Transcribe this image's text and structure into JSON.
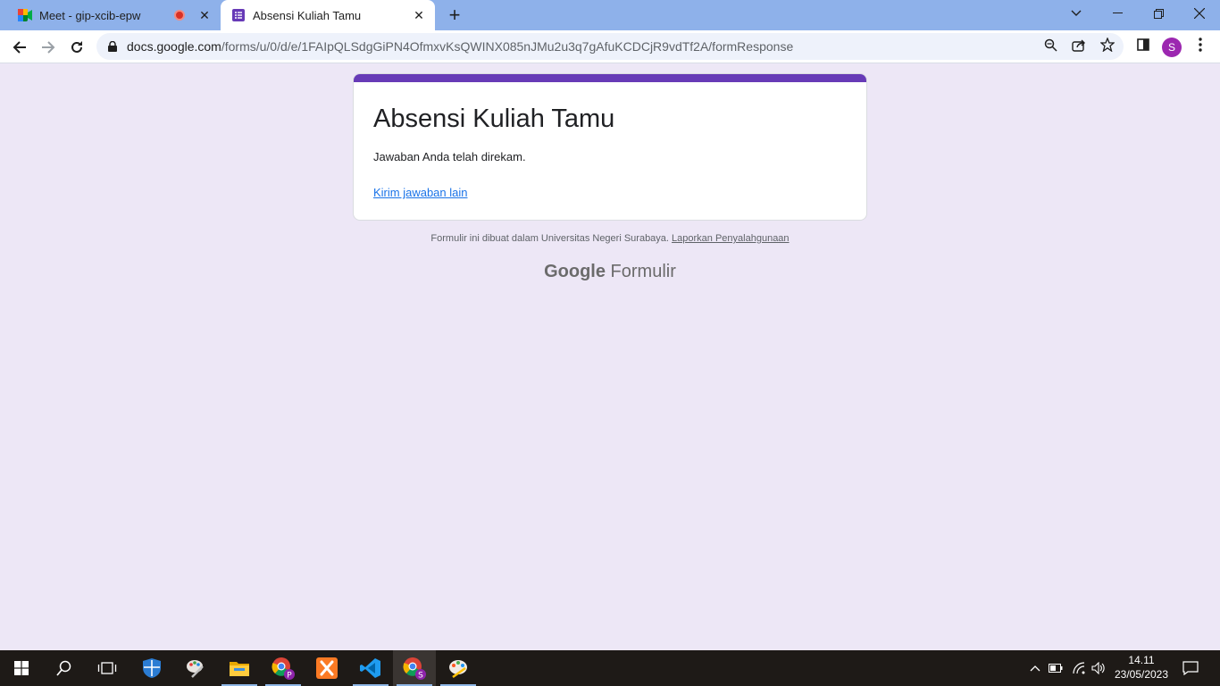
{
  "browser": {
    "tabs": [
      {
        "title": "Meet - gip-xcib-epw",
        "icon": "google-meet-icon",
        "recording": true
      },
      {
        "title": "Absensi Kuliah Tamu",
        "icon": "google-forms-icon"
      }
    ],
    "url_host": "docs.google.com",
    "url_path": "/forms/u/0/d/e/1FAIpQLSdgGiPN4OfmxvKsQWINX085nJMu2u3q7gAfuKCDCjR9vdTf2A/formResponse",
    "profile_initial": "S",
    "profile_color": "#9c27b0"
  },
  "form": {
    "title": "Absensi Kuliah Tamu",
    "message": "Jawaban Anda telah direkam.",
    "another_response_link": "Kirim jawaban lain",
    "accent_color": "#673ab7"
  },
  "footer": {
    "note": "Formulir ini dibuat dalam Universitas Negeri Surabaya.",
    "report_link": "Laporkan Penyalahgunaan",
    "brand_google": "Google",
    "brand_product": "Formulir"
  },
  "taskbar": {
    "apps": [
      "start-icon",
      "search-icon",
      "task-view-icon",
      "windows-security-icon",
      "paint-app-icon",
      "file-explorer-icon",
      "chrome-profile-p-icon",
      "xampp-icon",
      "vscode-icon",
      "chrome-profile-s-icon",
      "paint-3d-icon"
    ],
    "time": "14.11",
    "date": "23/05/2023"
  }
}
